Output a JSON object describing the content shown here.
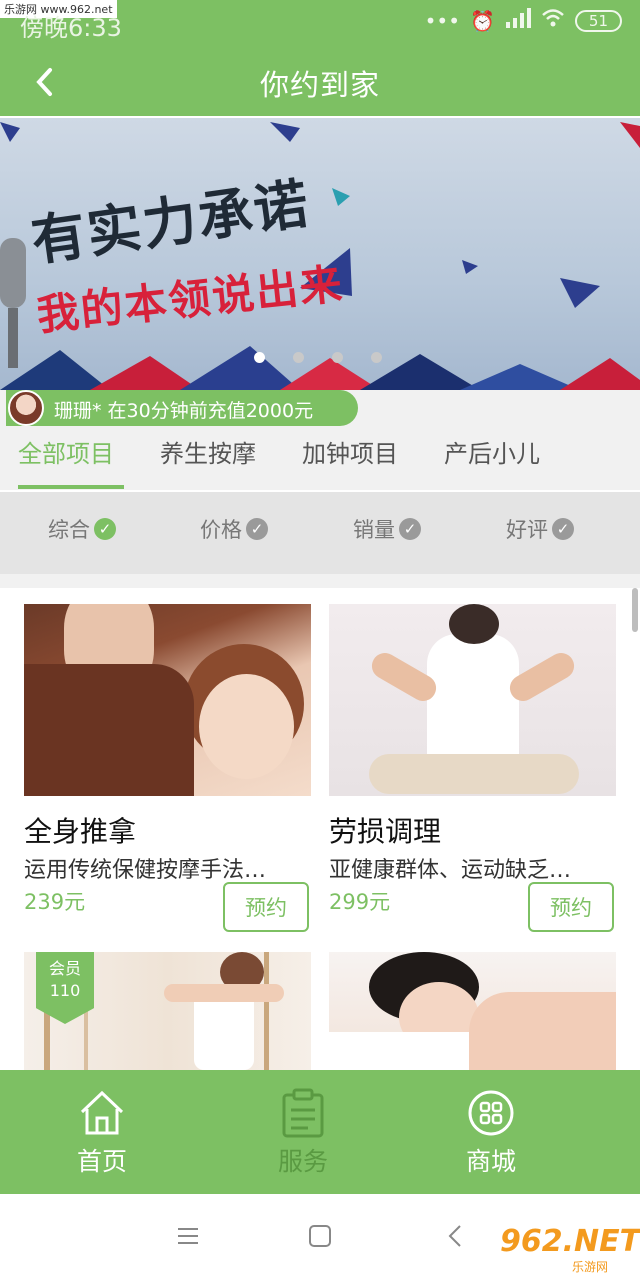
{
  "status_bar": {
    "time": "傍晚6:33",
    "battery": "51",
    "site_badge": "乐游网 www.962.net"
  },
  "header": {
    "title": "你约到家"
  },
  "banner": {
    "headline": "有实力承诺",
    "subline": "我的本领说出来",
    "dot_count": 4,
    "active_dot": 0
  },
  "notice": {
    "text": "珊珊* 在30分钟前充值2000元"
  },
  "tabs": [
    {
      "label": "全部项目",
      "active": true
    },
    {
      "label": "养生按摩",
      "active": false
    },
    {
      "label": "加钟项目",
      "active": false
    },
    {
      "label": "产后小儿",
      "active": false
    }
  ],
  "sort": [
    {
      "label": "综合",
      "active": true
    },
    {
      "label": "价格",
      "active": false
    },
    {
      "label": "销量",
      "active": false
    },
    {
      "label": "好评",
      "active": false
    }
  ],
  "products": [
    {
      "title": "全身推拿",
      "desc": "运用传统保健按摩手法…",
      "price": "239元",
      "button": "预约"
    },
    {
      "title": "劳损调理",
      "desc": "亚健康群体、运动缺乏…",
      "price": "299元",
      "button": "预约"
    },
    {
      "badge_line1": "会员",
      "badge_line2": "110"
    }
  ],
  "bottom_nav": [
    {
      "label": "首页",
      "icon": "home-icon"
    },
    {
      "label": "服务",
      "icon": "clipboard-icon"
    },
    {
      "label": "商城",
      "icon": "grid-icon"
    }
  ],
  "watermark": {
    "logo": "962.NET",
    "sub": "乐游网"
  },
  "colors": {
    "accent": "#7dc063",
    "price": "#7dc063"
  }
}
